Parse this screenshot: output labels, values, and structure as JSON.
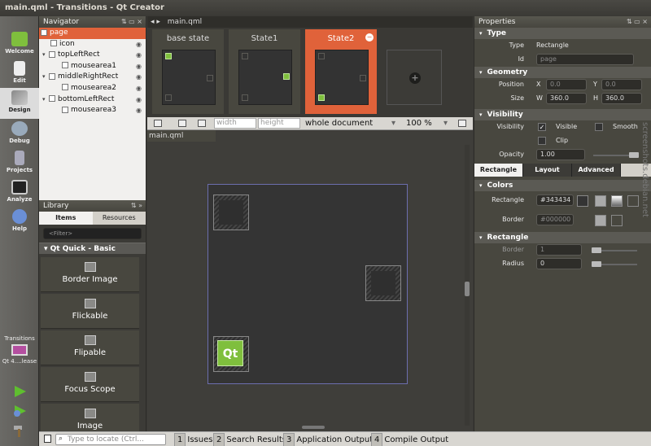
{
  "window": {
    "title": "main.qml - Transitions - Qt Creator"
  },
  "modes": [
    {
      "label": "Welcome",
      "icon": "qt-welcome-icon"
    },
    {
      "label": "Edit",
      "icon": "edit-document-icon"
    },
    {
      "label": "Design",
      "icon": "design-brush-icon"
    },
    {
      "label": "Debug",
      "icon": "debug-bug-icon"
    },
    {
      "label": "Projects",
      "icon": "projects-wrench-icon"
    },
    {
      "label": "Analyze",
      "icon": "analyze-monitor-icon"
    },
    {
      "label": "Help",
      "icon": "help-icon"
    }
  ],
  "target": {
    "project": "Transitions",
    "kit": "Qt 4....lease"
  },
  "navigator": {
    "title": "Navigator",
    "items": [
      {
        "name": "page"
      },
      {
        "name": "icon"
      },
      {
        "name": "topLeftRect"
      },
      {
        "name": "mousearea1"
      },
      {
        "name": "middleRightRect"
      },
      {
        "name": "mousearea2"
      },
      {
        "name": "bottomLeftRect"
      },
      {
        "name": "mousearea3"
      }
    ]
  },
  "library": {
    "title": "Library",
    "tabs": [
      "Items",
      "Resources"
    ],
    "filter_placeholder": "<Filter>",
    "group": "Qt Quick - Basic",
    "items": [
      "Border Image",
      "Flickable",
      "Flipable",
      "Focus Scope",
      "Image"
    ]
  },
  "editor": {
    "file_tab": "main.qml",
    "canvas_tab": "main.qml"
  },
  "states": [
    {
      "name": "base state"
    },
    {
      "name": "State1"
    },
    {
      "name": "State2"
    }
  ],
  "canvas_toolbar": {
    "width_placeholder": "width",
    "height_placeholder": "height",
    "scope": "whole document",
    "zoom": "100 %"
  },
  "properties": {
    "title": "Properties",
    "type_section": "Type",
    "type_label": "Type",
    "type_value": "Rectangle",
    "id_label": "Id",
    "id_value": "page",
    "geometry_section": "Geometry",
    "position_label": "Position",
    "x_label": "X",
    "x_value": "0.0",
    "y_label": "Y",
    "y_value": "0.0",
    "size_label": "Size",
    "w_label": "W",
    "w_value": "360.0",
    "h_label": "H",
    "h_value": "360.0",
    "visibility_section": "Visibility",
    "visibility_label": "Visibility",
    "visible_label": "Visible",
    "smooth_label": "Smooth",
    "clip_label": "Clip",
    "opacity_label": "Opacity",
    "opacity_value": "1.00",
    "tabs": [
      "Rectangle",
      "Layout",
      "Advanced"
    ],
    "colors_section": "Colors",
    "rect_color_label": "Rectangle",
    "rect_color_value": "#343434",
    "border_color_label": "Border",
    "border_color_value": "#000000",
    "rectangle_section": "Rectangle",
    "border_label": "Border",
    "border_value": "1",
    "radius_label": "Radius",
    "radius_value": "0"
  },
  "status_bar": {
    "locate_placeholder": "Type to locate (Ctrl...",
    "panes": [
      {
        "num": "1",
        "label": "Issues"
      },
      {
        "num": "2",
        "label": "Search Results"
      },
      {
        "num": "3",
        "label": "Application Output"
      },
      {
        "num": "4",
        "label": "Compile Output"
      }
    ]
  },
  "watermark": "screenshots.debian.net",
  "colors": {
    "accent": "#e0623a",
    "canvas_rect": "#343434",
    "qt_green": "#7fbf3d"
  }
}
